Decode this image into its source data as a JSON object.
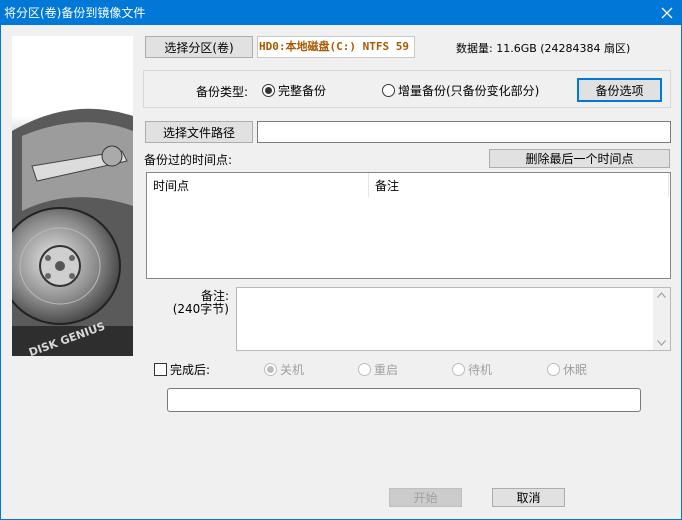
{
  "window": {
    "title": "将分区(卷)备份到镜像文件"
  },
  "source": {
    "select_partition_button": "选择分区(卷)",
    "partition_display": "HD0:本地磁盘(C:) NTFS 59",
    "data_amount_text": "数据量: 11.6GB (24284384 扇区)"
  },
  "backup_type": {
    "label": "备份类型:",
    "options": [
      "完整备份",
      "增量备份(只备份变化部分)"
    ],
    "selected": "完整备份",
    "options_button": "备份选项"
  },
  "file_path": {
    "select_path_button": "选择文件路径",
    "value": ""
  },
  "time_points": {
    "label": "备份过的时间点:",
    "delete_last_button": "删除最后一个时间点",
    "columns": [
      "时间点",
      "备注"
    ],
    "rows": []
  },
  "note": {
    "label_line1": "备注:",
    "label_line2": "(240字节)",
    "value": ""
  },
  "after_completion": {
    "label": "完成后:",
    "checked": false,
    "options": [
      "关机",
      "重启",
      "待机",
      "休眠"
    ],
    "selected": "关机"
  },
  "progress": {
    "percent": 0
  },
  "footer": {
    "start_button": "开始",
    "cancel_button": "取消"
  },
  "branding": {
    "logo_text": "DISK GENIUS"
  }
}
